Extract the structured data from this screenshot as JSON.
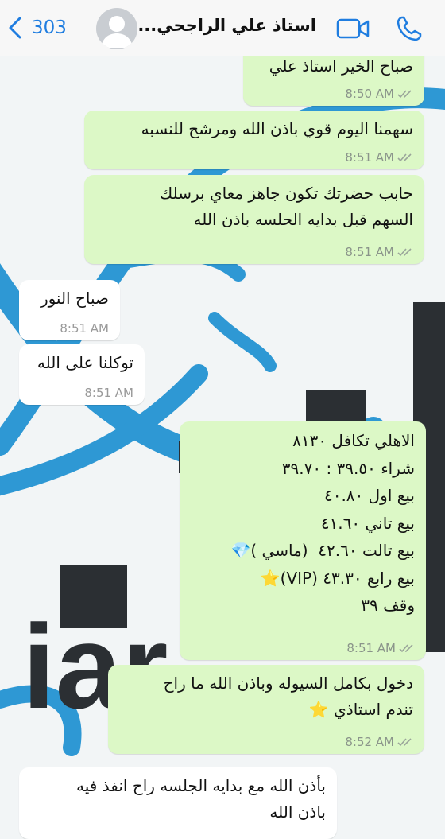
{
  "header": {
    "back_count": "303",
    "contact_name": "استاذ علي الراجحي..."
  },
  "messages": [
    {
      "text": "صباح الخير استاذ علي",
      "time": "8:50 AM"
    },
    {
      "text": "سهمنا اليوم قوي باذن الله ومرشح للنسبه",
      "time": "8:51 AM"
    },
    {
      "lines": [
        "حابب حضرتك تكون جاهز معاي برسلك",
        "السهم قبل بدايه الحلسه باذن الله"
      ],
      "time": "8:51 AM"
    },
    {
      "text": "صباح النور",
      "time": "8:51 AM"
    },
    {
      "text": "توكلنا على الله",
      "time": "8:51 AM"
    },
    {
      "lines": [
        "الاهلي تكافل ٨١٣٠",
        "شراء ٣٩.٥٠ : ٣٩.٧٠",
        "بيع اول ٤٠.٨٠",
        "بيع تاني ٤١.٦٠",
        "بيع تالت ٤٢.٦٠  (ماسي )💎",
        "بيع رابع ٤٣.٣٠ (VIP)⭐",
        "وقف ٣٩"
      ],
      "time": "8:51 AM"
    },
    {
      "lines": [
        "دخول بكامل السيوله وباذن الله ما راح",
        "تندم استاذي ⭐"
      ],
      "time": "8:52 AM"
    },
    {
      "lines": [
        "بأذن الله مع بدايه الجلسه راح انفذ فيه",
        "باذن الله"
      ]
    }
  ],
  "wallpaper": {
    "text_fragment": "iar"
  },
  "colors": {
    "outgoing_bubble": "#dcf8c6",
    "incoming_bubble": "#ffffff",
    "accent_blue": "#1f7de0",
    "wallpaper_swoosh": "#2e98d4"
  },
  "icons": [
    "chevron-left-icon",
    "avatar-icon",
    "video-icon",
    "phone-icon",
    "double-check-icon"
  ]
}
